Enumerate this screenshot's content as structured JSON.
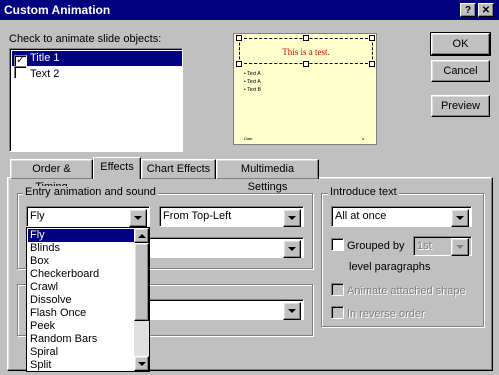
{
  "window": {
    "title": "Custom Animation",
    "help_glyph": "?",
    "close_glyph": "✕"
  },
  "objects": {
    "label": "Check to animate slide objects:",
    "items": [
      {
        "label": "Title 1",
        "checked": true,
        "selected": true
      },
      {
        "label": "Text 2",
        "checked": false,
        "selected": false
      }
    ]
  },
  "preview": {
    "title_text": "This is a test.",
    "bullets": [
      "Text A",
      "Text A",
      "Text B"
    ],
    "footer_left": "Date",
    "footer_right": "#"
  },
  "buttons": {
    "ok": "OK",
    "cancel": "Cancel",
    "preview": "Preview"
  },
  "tabs": [
    {
      "label": "Order & Timing",
      "active": false
    },
    {
      "label": "Effects",
      "active": true
    },
    {
      "label": "Chart Effects",
      "active": false
    },
    {
      "label": "Multimedia Settings",
      "active": false
    }
  ],
  "entry": {
    "group_label": "Entry animation and sound",
    "effect_value": "Fly",
    "direction_value": "From Top-Left",
    "dropdown_options": [
      "Fly",
      "Blinds",
      "Box",
      "Checkerboard",
      "Crawl",
      "Dissolve",
      "Flash Once",
      "Peek",
      "Random Bars",
      "Spiral",
      "Split"
    ],
    "dropdown_selected_index": 0
  },
  "introduce": {
    "group_label": "Introduce text",
    "value": "All at once",
    "grouped_label": "Grouped by",
    "grouped_value": "1st",
    "level_label": "level paragraphs",
    "animate_shape_label": "Animate attached shape",
    "reverse_label": "In reverse order"
  },
  "colors": {
    "titlebar": "#000080",
    "selection": "#000080",
    "dialog": "#c0c0c0",
    "preview_bg": "#ffffcc",
    "preview_title": "#cc0000"
  }
}
